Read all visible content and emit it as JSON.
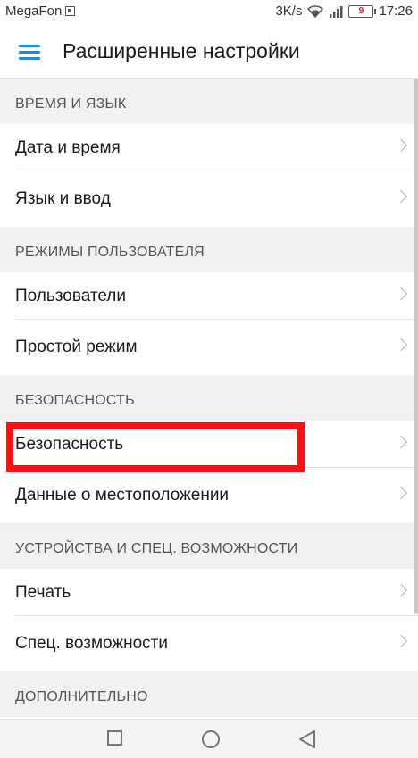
{
  "status_bar": {
    "carrier": "MegaFon",
    "network_speed": "3K/s",
    "battery_level": "9",
    "time": "17:26"
  },
  "app_bar": {
    "title": "Расширенные настройки"
  },
  "sections": [
    {
      "header": "ВРЕМЯ И ЯЗЫК",
      "items": [
        "Дата и время",
        "Язык и ввод"
      ]
    },
    {
      "header": "РЕЖИМЫ ПОЛЬЗОВАТЕЛЯ",
      "items": [
        "Пользователи",
        "Простой режим"
      ]
    },
    {
      "header": "БЕЗОПАСНОСТЬ",
      "items": [
        "Безопасность",
        "Данные о местоположении"
      ]
    },
    {
      "header": "УСТРОЙСТВА И СПЕЦ. ВОЗМОЖНОСТИ",
      "items": [
        "Печать",
        "Спец. возможности"
      ]
    },
    {
      "header": "ДОПОЛНИТЕЛЬНО",
      "items": []
    }
  ],
  "colors": {
    "accent": "#1e88e5",
    "highlight": "#ff1010",
    "battery_low": "#e0201c"
  }
}
